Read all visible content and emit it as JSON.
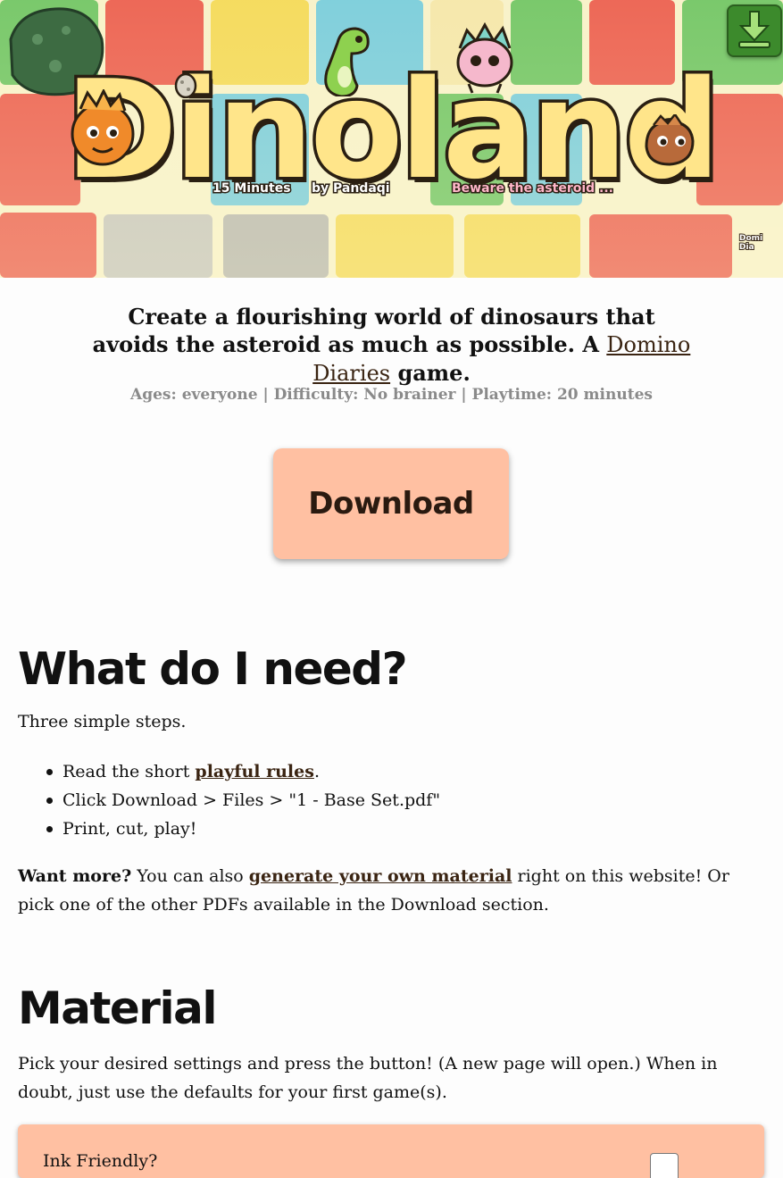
{
  "banner": {
    "title": "Dinoland",
    "taglines": [
      "15 Minutes",
      "by Pandaqi",
      "Beware the asteroid ..."
    ],
    "download_icon": "download-arrow-icon",
    "badge_text": "Domi Dia"
  },
  "intro": {
    "text_before": "Create a flourishing world of dinosaurs that avoids the asteroid as much as possible. A ",
    "link": "Domino Diaries",
    "text_after": " game."
  },
  "meta": "Ages: everyone | Difficulty: No brainer | Playtime: 20 minutes",
  "download_button": "Download",
  "need": {
    "heading": "What do I need?",
    "lead": "Three simple steps.",
    "step1_before": "Read the short ",
    "step1_link": "playful rules",
    "step1_after": ".",
    "step2": "Click Download > Files > \"1 - Base Set.pdf\"",
    "step3": "Print, cut, play!",
    "more_strong": "Want more?",
    "more_before": " You can also ",
    "more_link": "generate your own material",
    "more_after": " right on this website! Or pick one of the other PDFs available in the Download section."
  },
  "material": {
    "heading": "Material",
    "text": "Pick your desired settings and press the button! (A new page will open.) When in doubt, just use the defaults for your first game(s).",
    "first_setting_label": "Ink Friendly?"
  },
  "colors": {
    "accent": "#ffc0a2",
    "link": "#3a2412",
    "meta": "#8a8a8a"
  }
}
